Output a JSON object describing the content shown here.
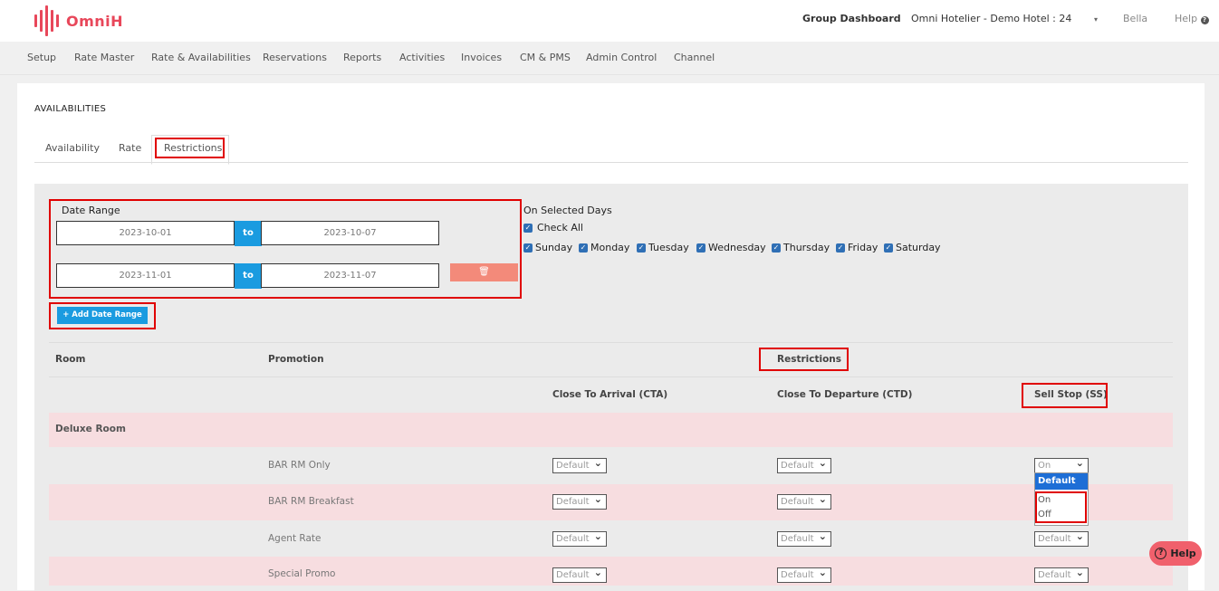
{
  "app": {
    "brand": "OmniH",
    "group_dashboard": "Group Dashboard",
    "hotel_select": "Omni Hotelier - Demo Hotel : 24",
    "user": "Bella",
    "help": "Help"
  },
  "nav": [
    "Setup",
    "Rate Master",
    "Rate & Availabilities",
    "Reservations",
    "Reports",
    "Activities",
    "Invoices",
    "CM & PMS",
    "Admin Control",
    "Channel"
  ],
  "page": {
    "heading": "AVAILABILITIES",
    "tabs": [
      "Availability",
      "Rate",
      "Restrictions"
    ]
  },
  "filters": {
    "date_range_label": "Date Range",
    "ranges": [
      {
        "from": "2023-10-01",
        "to": "2023-10-07"
      },
      {
        "from": "2023-11-01",
        "to": "2023-11-07"
      }
    ],
    "to_label": "to",
    "add_range_label": "+ Add Date Range",
    "selected_days_label": "On Selected Days",
    "check_all": "Check All",
    "days": [
      "Sunday",
      "Monday",
      "Tuesday",
      "Wednesday",
      "Thursday",
      "Friday",
      "Saturday"
    ]
  },
  "table": {
    "col_room": "Room",
    "col_promotion": "Promotion",
    "col_restrictions": "Restrictions",
    "sub_cta": "Close To Arrival (CTA)",
    "sub_ctd": "Close To Departure (CTD)",
    "sub_ss": "Sell Stop (SS)",
    "room_name": "Deluxe Room",
    "rows": [
      {
        "promotion": "BAR RM Only",
        "cta": "Default",
        "ctd": "Default",
        "ss": "On"
      },
      {
        "promotion": "BAR RM Breakfast",
        "cta": "Default",
        "ctd": "Default",
        "ss": "Default"
      },
      {
        "promotion": "Agent Rate",
        "cta": "Default",
        "ctd": "Default",
        "ss": "Default"
      },
      {
        "promotion": "Special Promo",
        "cta": "Default",
        "ctd": "Default",
        "ss": "Default"
      }
    ],
    "dropdown_options": [
      "Default",
      "On",
      "Off"
    ]
  },
  "help_fab": "Help",
  "colors": {
    "brand": "#e8475a",
    "primary": "#1a9be0",
    "highlight": "#e00000",
    "row_alt": "#f7dde0"
  }
}
